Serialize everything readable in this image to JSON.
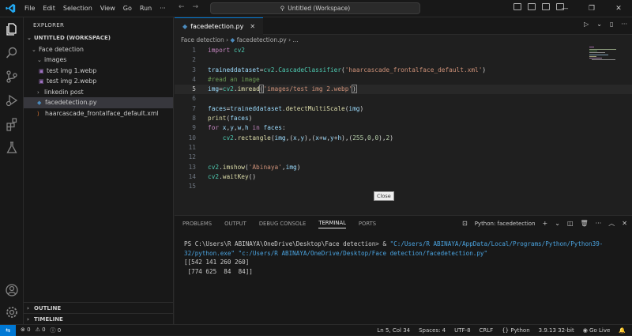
{
  "menu": [
    "File",
    "Edit",
    "Selection",
    "View",
    "Go",
    "Run",
    "···"
  ],
  "command_center": "Untitled (Workspace)",
  "sidebar": {
    "title": "EXPLORER",
    "workspace": "UNTITLED (WORKSPACE)",
    "tree": [
      {
        "label": "Face detection",
        "kind": "folder-open",
        "indent": 1
      },
      {
        "label": "images",
        "kind": "folder-open",
        "indent": 2
      },
      {
        "label": "test img 1.webp",
        "kind": "image",
        "indent": 3
      },
      {
        "label": "test img 2.webp",
        "kind": "image",
        "indent": 3
      },
      {
        "label": "linkedin post",
        "kind": "folder-closed",
        "indent": 2
      },
      {
        "label": "facedetection.py",
        "kind": "python",
        "indent": 2,
        "selected": true
      },
      {
        "label": "haarcascade_frontalface_default.xml",
        "kind": "xml",
        "indent": 2
      }
    ],
    "outline": "OUTLINE",
    "timeline": "TIMELINE"
  },
  "editor": {
    "tab_label": "facedetection.py",
    "breadcrumb_folder": "Face detection",
    "breadcrumb_file": "facedetection.py",
    "breadcrumb_more": "...",
    "line_numbers": [
      "1",
      "2",
      "3",
      "4",
      "5",
      "6",
      "7",
      "8",
      "9",
      "10",
      "11",
      "12",
      "13",
      "14",
      "15"
    ],
    "tooltip": "Close"
  },
  "panel": {
    "tabs": [
      "PROBLEMS",
      "OUTPUT",
      "DEBUG CONSOLE",
      "TERMINAL",
      "PORTS"
    ],
    "active_tab": "TERMINAL",
    "terminal_name": "Python: facedetection",
    "prompt": "PS C:\\Users\\R ABINAYA\\OneDrive\\Desktop\\Face detection> & ",
    "cmd_exe": "\"C:/Users/R ABINAYA/AppData/Local/Programs/Python/Python39-32/python.exe\"",
    "cmd_script": "\"c:/Users/R ABINAYA/OneDrive/Desktop/Face detection/facedetection.py\"",
    "out1": "[[542 141 260 260]",
    "out2": " [774 625  84  84]]"
  },
  "status": {
    "errors": "0",
    "warnings": "0",
    "info": "0",
    "position": "Ln 5, Col 34",
    "spaces": "Spaces: 4",
    "encoding": "UTF-8",
    "eol": "CRLF",
    "language": "Python",
    "interpreter": "3.9.13 32-bit",
    "golive": "Go Live"
  },
  "colors": {
    "accent": "#0078d4",
    "bg": "#1f1f1f",
    "sidebar": "#181818"
  }
}
